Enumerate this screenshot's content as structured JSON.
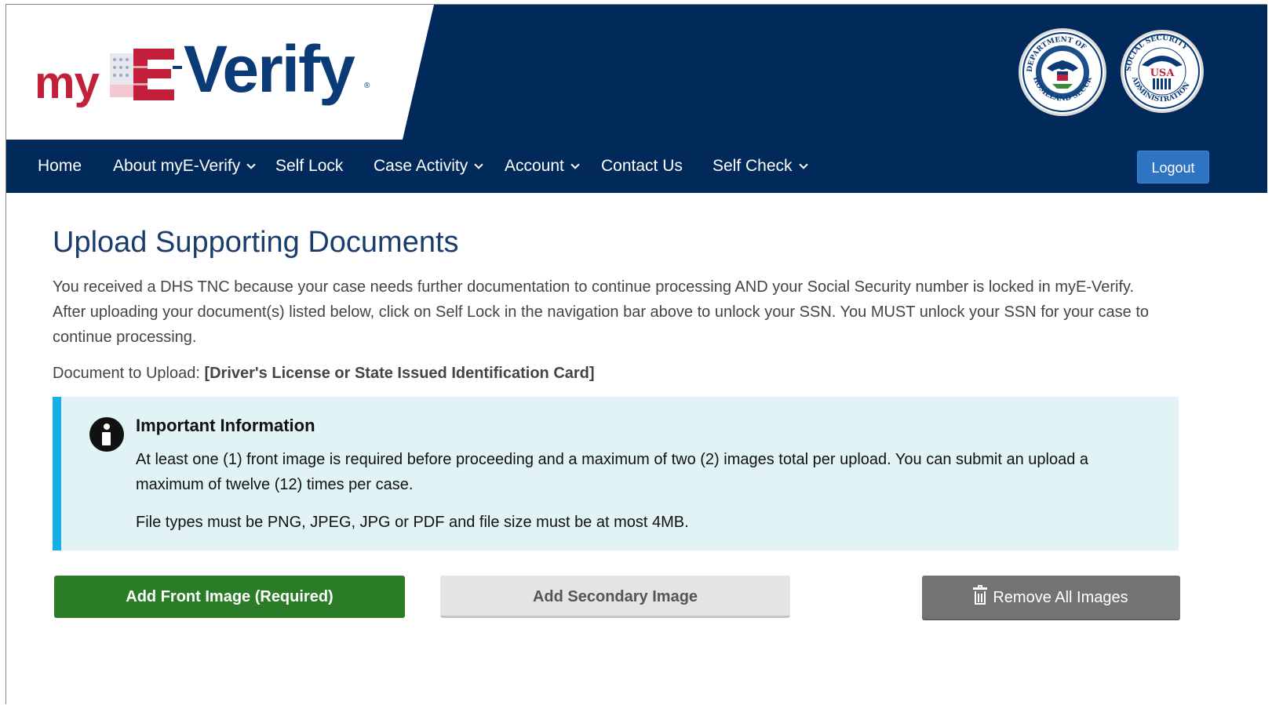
{
  "header": {
    "logo_my": "my",
    "logo_e": "E",
    "logo_verify": "Verify",
    "seal_dhs_text": "U.S. DEPARTMENT OF HOMELAND SECURITY",
    "seal_ssa_text": "SOCIAL SECURITY ADMINISTRATION",
    "seal_ssa_usa": "USA"
  },
  "nav": {
    "items": [
      {
        "label": "Home",
        "has_dropdown": false
      },
      {
        "label": "About myE-Verify",
        "has_dropdown": true
      },
      {
        "label": "Self Lock",
        "has_dropdown": false
      },
      {
        "label": "Case Activity",
        "has_dropdown": true
      },
      {
        "label": "Account",
        "has_dropdown": true
      },
      {
        "label": "Contact Us",
        "has_dropdown": false
      },
      {
        "label": "Self Check",
        "has_dropdown": true
      }
    ],
    "logout_label": "Logout"
  },
  "main": {
    "title": "Upload Supporting Documents",
    "intro": "You received a DHS TNC because your case needs further documentation to continue processing AND your Social Security number is locked in myE-Verify. After uploading your document(s) listed below, click on Self Lock in the navigation bar above to unlock your SSN. You MUST unlock your SSN for your case to continue processing.",
    "doc_prefix": "Document to Upload: ",
    "doc_name": "[Driver's License or State Issued Identification Card]",
    "alert": {
      "title": "Important Information",
      "body": "At least one (1) front image is required before proceeding and a maximum of two (2) images total per upload. You can submit an upload a maximum of twelve (12) times per case.",
      "body2": "File types must be PNG, JPEG, JPG or PDF and file size must be at most 4MB."
    },
    "buttons": {
      "front": "Add Front Image (Required)",
      "secondary": "Add Secondary Image",
      "remove": "Remove All Images"
    }
  },
  "colors": {
    "navy": "#012a5b",
    "title_blue": "#1a3d6c",
    "logout_blue": "#2e74c2",
    "alert_bg": "#e2f3f6",
    "alert_border": "#13aee6",
    "green": "#2a7d26",
    "grey_button": "#737373",
    "red": "#c21f3a"
  },
  "icons": [
    "info-icon",
    "trash-icon",
    "chevron-down-icon"
  ]
}
